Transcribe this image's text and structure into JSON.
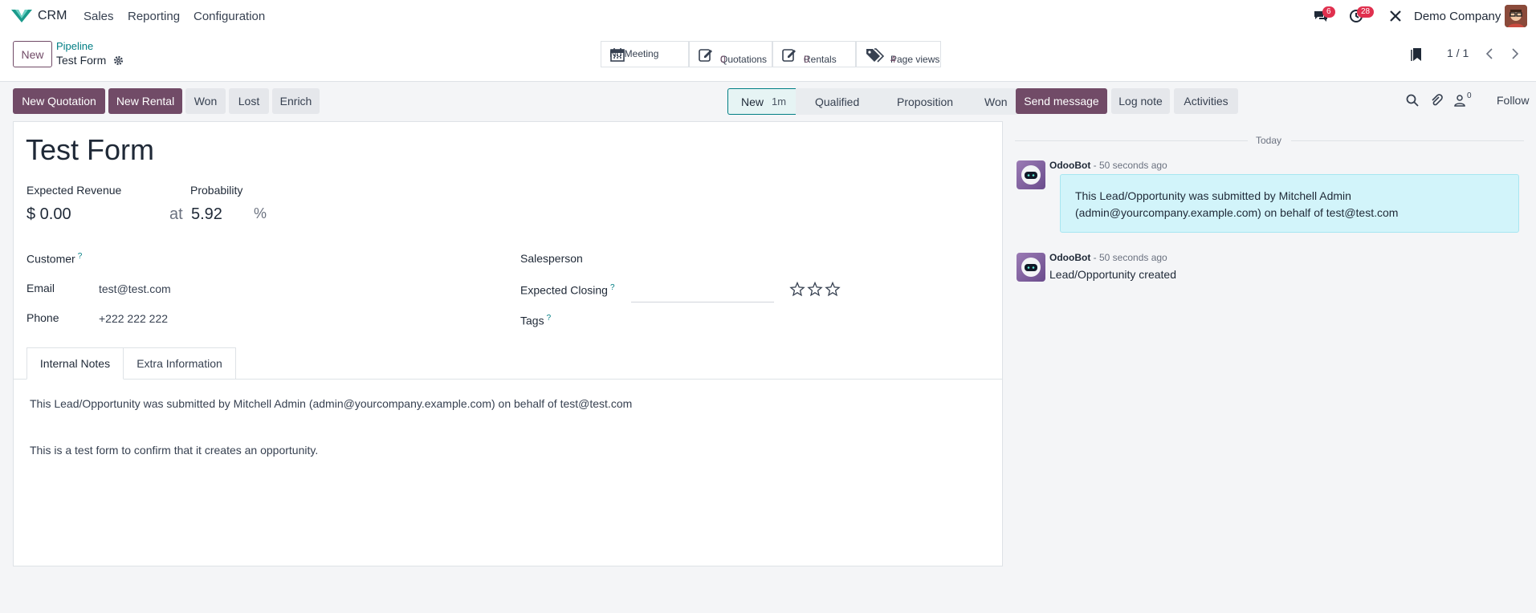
{
  "navbar": {
    "app": "CRM",
    "menus": [
      "Sales",
      "Reporting",
      "Configuration"
    ],
    "messages_badge": "6",
    "activities_badge": "28",
    "company": "Demo Company",
    "colors": {
      "brand": "#714b67",
      "badge": "#e0304e",
      "link": "#017e84"
    }
  },
  "control": {
    "new_label": "New",
    "breadcrumb_parent": "Pipeline",
    "breadcrumb_current": "Test Form",
    "pager": "1 / 1"
  },
  "smart_buttons": {
    "meeting": "No Meeting",
    "quotations_label": "Quotations",
    "quotations_value": "0",
    "rentals_label": "Rentals",
    "rentals_value": "0",
    "pageviews_label": "Page views",
    "pageviews_value": "4"
  },
  "actions": {
    "new_quotation": "New Quotation",
    "new_rental": "New Rental",
    "won": "Won",
    "lost": "Lost",
    "enrich": "Enrich"
  },
  "stages": [
    {
      "label": "New",
      "duration": "1m",
      "active": true
    },
    {
      "label": "Qualified"
    },
    {
      "label": "Proposition"
    },
    {
      "label": "Won"
    }
  ],
  "form": {
    "title": "Test Form",
    "expected_revenue_label": "Expected Revenue",
    "expected_revenue": "$ 0.00",
    "at": "at",
    "probability_label": "Probability",
    "probability": "5.92",
    "percent": "%",
    "customer_label": "Customer",
    "email_label": "Email",
    "email": "test@test.com",
    "phone_label": "Phone",
    "phone": "+222 222 222",
    "salesperson_label": "Salesperson",
    "expected_closing_label": "Expected Closing",
    "tags_label": "Tags",
    "help_mark": "?",
    "priority_stars": 0
  },
  "tabs": {
    "internal_notes": "Internal Notes",
    "extra_information": "Extra Information"
  },
  "notes": {
    "line1": "This Lead/Opportunity was submitted by Mitchell Admin (admin@yourcompany.example.com) on behalf of test@test.com",
    "line2": "This is a test form to confirm that it creates an opportunity."
  },
  "chatter": {
    "send_message": "Send message",
    "log_note": "Log note",
    "activities": "Activities",
    "followers_count": "0",
    "follow": "Follow",
    "today": "Today",
    "messages": [
      {
        "author": "OdooBot",
        "time": "- 50 seconds ago",
        "body": "This Lead/Opportunity was submitted by Mitchell Admin (admin@yourcompany.example.com) on behalf of test@test.com"
      },
      {
        "author": "OdooBot",
        "time": "- 50 seconds ago",
        "body": "Lead/Opportunity created"
      }
    ]
  }
}
